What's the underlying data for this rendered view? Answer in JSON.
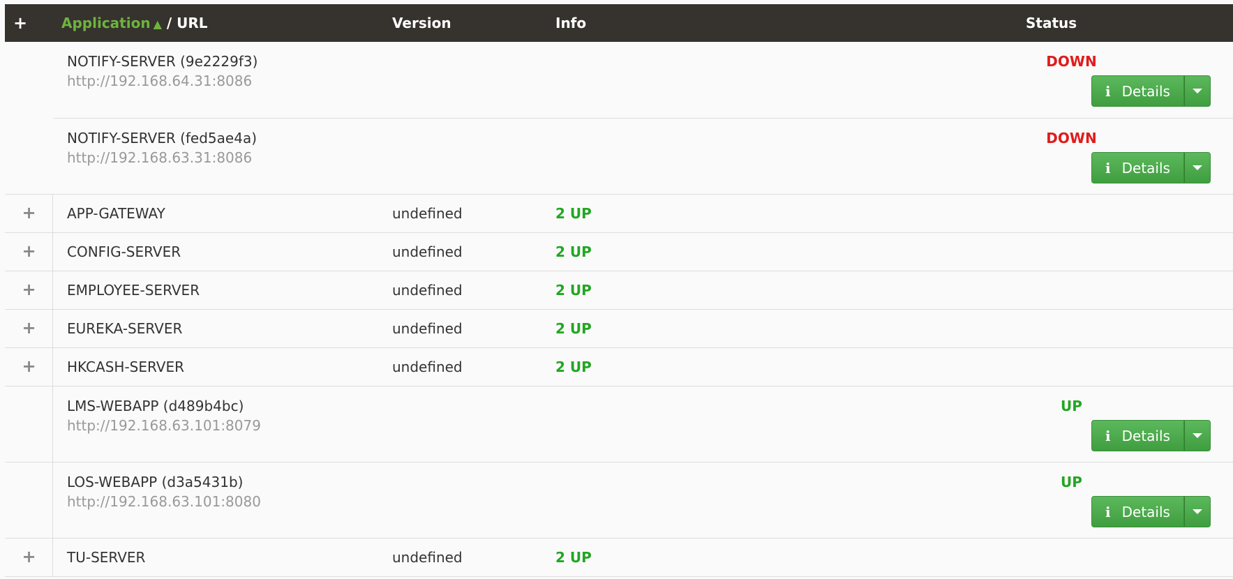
{
  "header": {
    "expand_icon": "+",
    "application_label": "Application",
    "sort_icon": "▲",
    "url_label": "/ URL",
    "version_label": "Version",
    "info_label": "Info",
    "status_label": "Status"
  },
  "button": {
    "details_label": "Details",
    "info_icon": "i"
  },
  "notify": {
    "collapse_icon": "−",
    "instances": [
      {
        "name": "NOTIFY-SERVER (9e2229f3)",
        "url": "http://192.168.64.31:8086",
        "status": "DOWN"
      },
      {
        "name": "NOTIFY-SERVER (fed5ae4a)",
        "url": "http://192.168.63.31:8086",
        "status": "DOWN"
      }
    ]
  },
  "groups": [
    {
      "name": "APP-GATEWAY",
      "version": "undefined",
      "info": "2 UP"
    },
    {
      "name": "CONFIG-SERVER",
      "version": "undefined",
      "info": "2 UP"
    },
    {
      "name": "EMPLOYEE-SERVER",
      "version": "undefined",
      "info": "2 UP"
    },
    {
      "name": "EUREKA-SERVER",
      "version": "undefined",
      "info": "2 UP"
    },
    {
      "name": "HKCASH-SERVER",
      "version": "undefined",
      "info": "2 UP"
    }
  ],
  "instances": [
    {
      "name": "LMS-WEBAPP (d489b4bc)",
      "url": "http://192.168.63.101:8079",
      "status": "UP"
    },
    {
      "name": "LOS-WEBAPP (d3a5431b)",
      "url": "http://192.168.63.101:8080",
      "status": "UP"
    }
  ],
  "last_group": {
    "name": "TU-SERVER",
    "version": "undefined",
    "info": "2 UP"
  },
  "colors": {
    "header_bg": "#36322d",
    "accent_green": "#6db33f",
    "status_up": "#22a622",
    "status_down": "#e21b1b",
    "button_green": "#5cb85c"
  }
}
